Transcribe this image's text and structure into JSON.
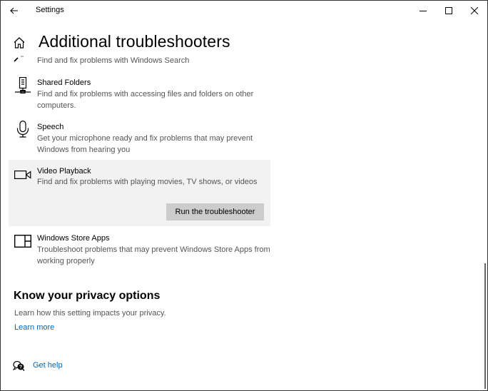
{
  "window": {
    "title": "Settings",
    "controls": {
      "minimize": "minimize-icon",
      "maximize": "maximize-icon",
      "close": "close-icon"
    }
  },
  "header": {
    "back_icon": "back-arrow-icon",
    "home_icon": "home-icon",
    "page_title": "Additional troubleshooters"
  },
  "troubleshooters": [
    {
      "name": "",
      "description": "Find and fix problems with Windows Search",
      "icon": "search-icon",
      "partial": true
    },
    {
      "name": "Shared Folders",
      "description": "Find and fix problems with accessing files and folders on other computers.",
      "icon": "shared-folders-icon"
    },
    {
      "name": "Speech",
      "description": "Get your microphone ready and fix problems that may prevent Windows from hearing you",
      "icon": "microphone-icon"
    },
    {
      "name": "Video Playback",
      "description": "Find and fix problems with playing movies, TV shows, or videos",
      "icon": "video-camera-icon",
      "selected": true,
      "action_label": "Run the troubleshooter"
    },
    {
      "name": "Windows Store Apps",
      "description": "Troubleshoot problems that may prevent Windows Store Apps from working properly",
      "icon": "store-apps-icon"
    }
  ],
  "privacy": {
    "title": "Know your privacy options",
    "description": "Learn how this setting impacts your privacy.",
    "link": "Learn more"
  },
  "help": {
    "icon": "get-help-icon",
    "label": "Get help"
  },
  "colors": {
    "accent_link": "#0067b8",
    "selected_bg": "#f2f2f2",
    "button_bg": "#cccccc",
    "secondary_text": "#555555"
  }
}
